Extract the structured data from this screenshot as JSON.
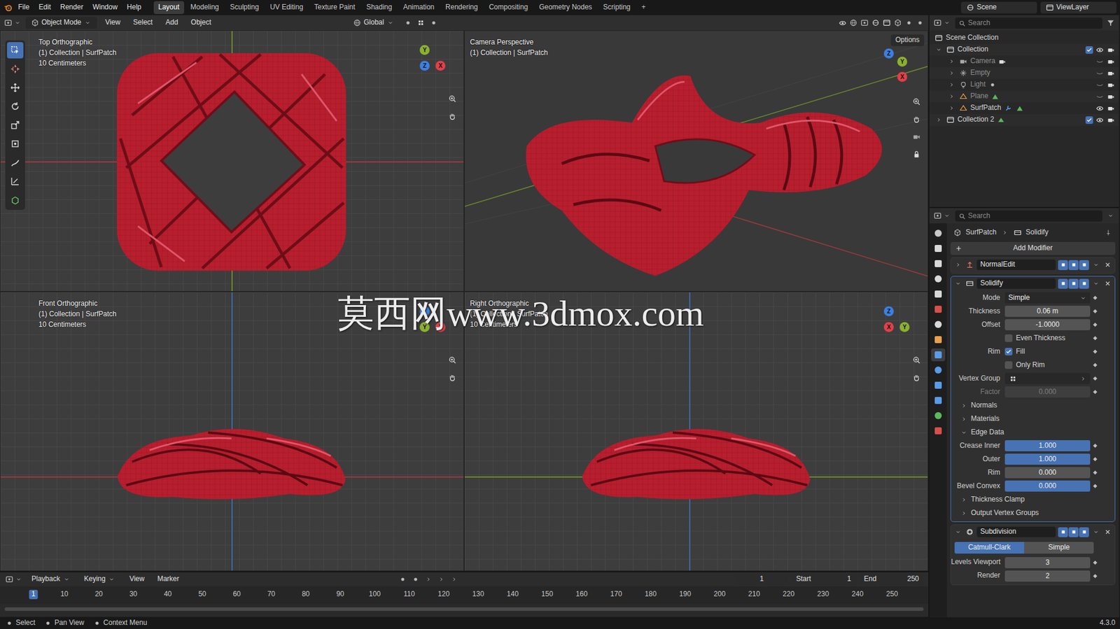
{
  "top_bar": {
    "menus": [
      "File",
      "Edit",
      "Render",
      "Window",
      "Help"
    ],
    "workspaces": [
      {
        "label": "Layout",
        "selected": true
      },
      {
        "label": "Modeling",
        "selected": false
      },
      {
        "label": "Sculpting",
        "selected": false
      },
      {
        "label": "UV Editing",
        "selected": false
      },
      {
        "label": "Texture Paint",
        "selected": false
      },
      {
        "label": "Shading",
        "selected": false
      },
      {
        "label": "Animation",
        "selected": false
      },
      {
        "label": "Rendering",
        "selected": false
      },
      {
        "label": "Compositing",
        "selected": false
      },
      {
        "label": "Geometry Nodes",
        "selected": false
      },
      {
        "label": "Scripting",
        "selected": false
      }
    ],
    "add_workspace": "+",
    "scene": "Scene",
    "view_layer": "ViewLayer"
  },
  "viewport_header": {
    "mode": "Object Mode",
    "menus": [
      "View",
      "Select",
      "Add",
      "Object"
    ],
    "orientation": "Global",
    "options": "Options"
  },
  "toolbar": [
    {
      "kind": "select",
      "selected": true
    },
    {
      "kind": "cursor",
      "selected": false
    },
    {
      "kind": "move",
      "selected": false
    },
    {
      "kind": "rotate",
      "selected": false
    },
    {
      "kind": "scale",
      "selected": false
    },
    {
      "kind": "transform",
      "selected": false
    },
    {
      "kind": "annotate",
      "selected": false
    },
    {
      "kind": "measure",
      "selected": false
    },
    {
      "kind": "add",
      "selected": false
    }
  ],
  "viewports": [
    {
      "kind": "top",
      "title": "Top Orthographic",
      "lines": [
        "(1) Collection | SurfPatch",
        "10 Centimeters"
      ],
      "gizmo": [
        {
          "label": "Y",
          "color": "#8bb030"
        },
        {
          "label": "Z",
          "color": "#3d7fe0"
        },
        {
          "label": "X",
          "color": "#e0404a"
        }
      ]
    },
    {
      "kind": "cam",
      "title": "Camera Perspective",
      "lines": [
        "(1) Collection | SurfPatch"
      ],
      "gizmo": [
        {
          "label": "Z",
          "color": "#3d7fe0"
        },
        {
          "label": "Y",
          "color": "#8bb030"
        },
        {
          "label": "X",
          "color": "#e0404a"
        }
      ]
    },
    {
      "kind": "front",
      "title": "Front Orthographic",
      "lines": [
        "(1) Collection | SurfPatch",
        "10 Centimeters"
      ],
      "gizmo": [
        {
          "label": "Z",
          "color": "#3d7fe0"
        },
        {
          "label": "Y",
          "color": "#8bb030"
        },
        {
          "label": "X",
          "color": "#e0404a"
        }
      ]
    },
    {
      "kind": "right",
      "title": "Right Orthographic",
      "lines": [
        "(1) Collection | SurfPatch",
        "10 Centimeters"
      ],
      "gizmo": [
        {
          "label": "Z",
          "color": "#3d7fe0"
        },
        {
          "label": "X",
          "color": "#e0404a"
        },
        {
          "label": "Y",
          "color": "#8bb030"
        }
      ]
    }
  ],
  "watermark": "莫西网www.3dmox.com",
  "outliner": {
    "search": "Search",
    "root": "Scene Collection",
    "collections": [
      {
        "label": "Collection",
        "expanded": true,
        "checked": true,
        "objects": [
          {
            "label": "Camera",
            "kind": "camera",
            "visible": false
          },
          {
            "label": "Empty",
            "kind": "empty",
            "visible": false
          },
          {
            "label": "Light",
            "kind": "light",
            "visible": false
          },
          {
            "label": "Plane",
            "kind": "mesh",
            "visible": false
          },
          {
            "label": "SurfPatch",
            "kind": "mesh_mod",
            "visible": true
          }
        ]
      },
      {
        "label": "Collection 2",
        "expanded": false,
        "checked": true,
        "objects": []
      }
    ]
  },
  "properties": {
    "search": "Search",
    "breadcrumb": [
      "SurfPatch",
      "Solidify"
    ],
    "add_modifier": "Add Modifier",
    "tabs": [
      {
        "kind": "tool",
        "selected": false
      },
      {
        "kind": "render",
        "selected": false
      },
      {
        "kind": "output",
        "selected": false
      },
      {
        "kind": "view_layer",
        "selected": false
      },
      {
        "kind": "scene",
        "selected": false
      },
      {
        "kind": "world",
        "selected": false
      },
      {
        "kind": "collection",
        "selected": false
      },
      {
        "kind": "object",
        "selected": false
      },
      {
        "kind": "modifier",
        "selected": true
      },
      {
        "kind": "particles",
        "selected": false
      },
      {
        "kind": "physics",
        "selected": false
      },
      {
        "kind": "constraints",
        "selected": false
      },
      {
        "kind": "data",
        "selected": false
      },
      {
        "kind": "material",
        "selected": false
      }
    ],
    "modifiers": [
      {
        "name": "NormalEdit",
        "kind": "normaledit",
        "expanded": false,
        "active": false,
        "rows": []
      },
      {
        "name": "Solidify",
        "kind": "solidify",
        "expanded": true,
        "active": true,
        "rows": [
          {
            "kind": "select",
            "label": "Mode",
            "value": "Simple"
          },
          {
            "kind": "field",
            "label": "Thickness",
            "value": "0.06 m",
            "disabled": false
          },
          {
            "kind": "field",
            "label": "Offset",
            "value": "-1.0000",
            "disabled": false
          },
          {
            "kind": "check",
            "label": "",
            "text": "Even Thickness",
            "checked": false
          },
          {
            "kind": "check",
            "label": "Rim",
            "text": "Fill",
            "checked": true
          },
          {
            "kind": "check",
            "label": "",
            "text": "Only Rim",
            "checked": false
          },
          {
            "kind": "group",
            "label": "Vertex Group"
          },
          {
            "kind": "field",
            "label": "Factor",
            "value": "0.000",
            "disabled": true
          },
          {
            "kind": "subpanel",
            "label": "Normals",
            "expanded": false
          },
          {
            "kind": "subpanel",
            "label": "Materials",
            "expanded": false
          },
          {
            "kind": "subpanel",
            "label": "Edge Data",
            "expanded": true
          },
          {
            "kind": "slider",
            "label": "Crease Inner",
            "value": "1.000",
            "level": 1
          },
          {
            "kind": "slider",
            "label": "Outer",
            "value": "1.000",
            "level": 1
          },
          {
            "kind": "slider",
            "label": "Rim",
            "value": "0.000",
            "level": 0
          },
          {
            "kind": "slider",
            "label": "Bevel Convex",
            "value": "0.000",
            "level": 1
          },
          {
            "kind": "subpanel",
            "label": "Thickness Clamp",
            "expanded": false
          },
          {
            "kind": "subpanel",
            "label": "Output Vertex Groups",
            "expanded": false
          }
        ]
      },
      {
        "name": "Subdivision",
        "kind": "subdivision",
        "expanded": true,
        "active": false,
        "rows": [
          {
            "kind": "toggle",
            "options": [
              {
                "label": "Catmull-Clark",
                "selected": true
              },
              {
                "label": "Simple",
                "selected": false
              }
            ]
          },
          {
            "kind": "field",
            "label": "Levels Viewport",
            "value": "3",
            "disabled": false
          },
          {
            "kind": "field",
            "label": "Render",
            "value": "2",
            "disabled": false
          }
        ]
      }
    ]
  },
  "timeline": {
    "menus": [
      "Playback",
      "Keying",
      "View",
      "Marker"
    ],
    "current": "1",
    "start_label": "Start",
    "start": "1",
    "end_label": "End",
    "end": "250",
    "ticks": [
      {
        "label": "1",
        "selected": true
      },
      {
        "label": "10",
        "selected": false
      },
      {
        "label": "20",
        "selected": false
      },
      {
        "label": "30",
        "selected": false
      },
      {
        "label": "40",
        "selected": false
      },
      {
        "label": "50",
        "selected": false
      },
      {
        "label": "60",
        "selected": false
      },
      {
        "label": "70",
        "selected": false
      },
      {
        "label": "80",
        "selected": false
      },
      {
        "label": "90",
        "selected": false
      },
      {
        "label": "100",
        "selected": false
      },
      {
        "label": "110",
        "selected": false
      },
      {
        "label": "120",
        "selected": false
      },
      {
        "label": "130",
        "selected": false
      },
      {
        "label": "140",
        "selected": false
      },
      {
        "label": "150",
        "selected": false
      },
      {
        "label": "160",
        "selected": false
      },
      {
        "label": "170",
        "selected": false
      },
      {
        "label": "180",
        "selected": false
      },
      {
        "label": "190",
        "selected": false
      },
      {
        "label": "200",
        "selected": false
      },
      {
        "label": "210",
        "selected": false
      },
      {
        "label": "220",
        "selected": false
      },
      {
        "label": "230",
        "selected": false
      },
      {
        "label": "240",
        "selected": false
      },
      {
        "label": "250",
        "selected": false
      }
    ]
  },
  "status_bar": {
    "items": [
      "Select",
      "Pan View",
      "Context Menu"
    ],
    "version": "4.3.0"
  }
}
